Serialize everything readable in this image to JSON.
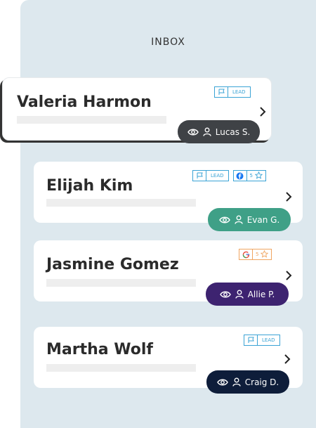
{
  "panel": {
    "title": "INBOX"
  },
  "conversations": [
    {
      "name": "Valeria Harmon",
      "tags": [
        {
          "type": "lead",
          "icon": "flag-icon",
          "label": "LEAD"
        }
      ],
      "assignee": "Lucas S.",
      "pill_color": "#3f4246",
      "selected": true
    },
    {
      "name": "Elijah Kim",
      "tags": [
        {
          "type": "lead",
          "icon": "flag-icon",
          "label": "LEAD"
        },
        {
          "type": "rating",
          "icon": "facebook-icon",
          "rating": "5"
        }
      ],
      "assignee": "Evan G.",
      "pill_color": "#3fa087",
      "selected": false
    },
    {
      "name": "Jasmine Gomez",
      "tags": [
        {
          "type": "rating",
          "icon": "google-icon",
          "rating": "5"
        }
      ],
      "assignee": "Allie P.",
      "pill_color": "#3d2370",
      "selected": false
    },
    {
      "name": "Martha Wolf",
      "tags": [
        {
          "type": "lead",
          "icon": "flag-icon",
          "label": "LEAD"
        }
      ],
      "assignee": "Craig D.",
      "pill_color": "#0e1d3a",
      "selected": false
    }
  ],
  "icons": {
    "view": "eye-icon",
    "user": "user-icon",
    "open": "chevron-right-icon",
    "star": "star-icon"
  }
}
